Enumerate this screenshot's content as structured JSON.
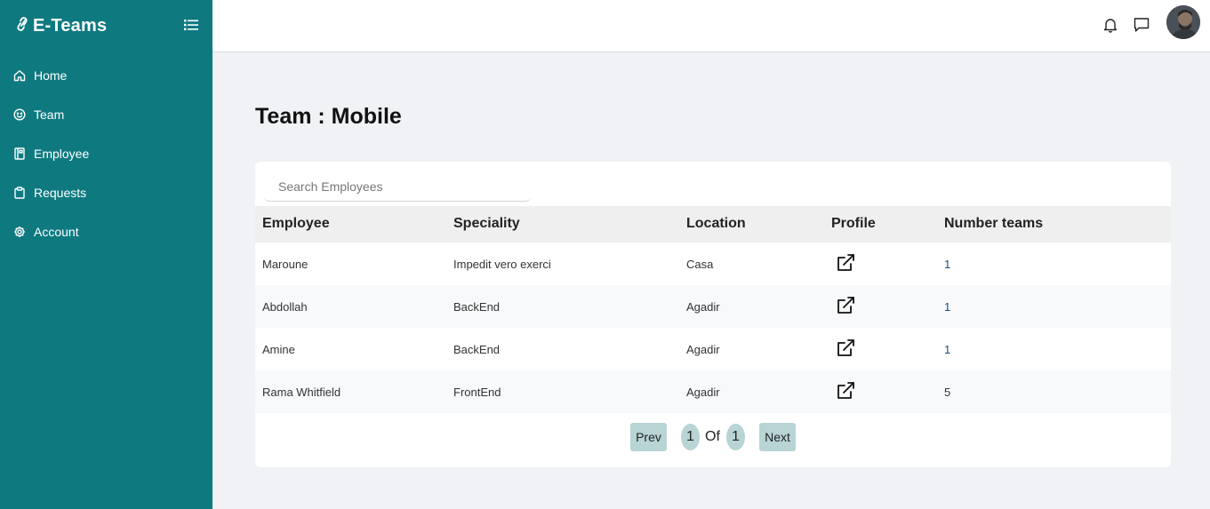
{
  "brand": {
    "name": "E-Teams",
    "logo_icon": "link-icon"
  },
  "sidebar": {
    "items": [
      {
        "label": "Home",
        "icon": "home-icon"
      },
      {
        "label": "Team",
        "icon": "smile-icon"
      },
      {
        "label": "Employee",
        "icon": "book-icon"
      },
      {
        "label": "Requests",
        "icon": "clipboard-icon"
      },
      {
        "label": "Account",
        "icon": "gear-icon"
      }
    ]
  },
  "topbar": {
    "icons": [
      "bell-icon",
      "chat-icon",
      "avatar"
    ]
  },
  "page": {
    "title": "Team : Mobile"
  },
  "search": {
    "placeholder": "Search Employees",
    "value": ""
  },
  "table": {
    "columns": [
      "Employee",
      "Speciality",
      "Location",
      "Profile",
      "Number teams"
    ],
    "rows": [
      {
        "employee": "Maroune",
        "speciality": "Impedit vero exerci",
        "location": "Casa",
        "teams": "1"
      },
      {
        "employee": "Abdollah",
        "speciality": "BackEnd",
        "location": "Agadir",
        "teams": "1"
      },
      {
        "employee": "Amine",
        "speciality": "BackEnd",
        "location": "Agadir",
        "teams": "1"
      },
      {
        "employee": "Rama Whitfield",
        "speciality": "FrontEnd",
        "location": "Agadir",
        "teams": "5"
      }
    ]
  },
  "pagination": {
    "prev_label": "Prev",
    "next_label": "Next",
    "current": "1",
    "of_label": "Of",
    "total": "1"
  },
  "colors": {
    "sidebar": "#0e7a80",
    "background": "#f0f2f5",
    "pager": "#b8d4d5"
  }
}
